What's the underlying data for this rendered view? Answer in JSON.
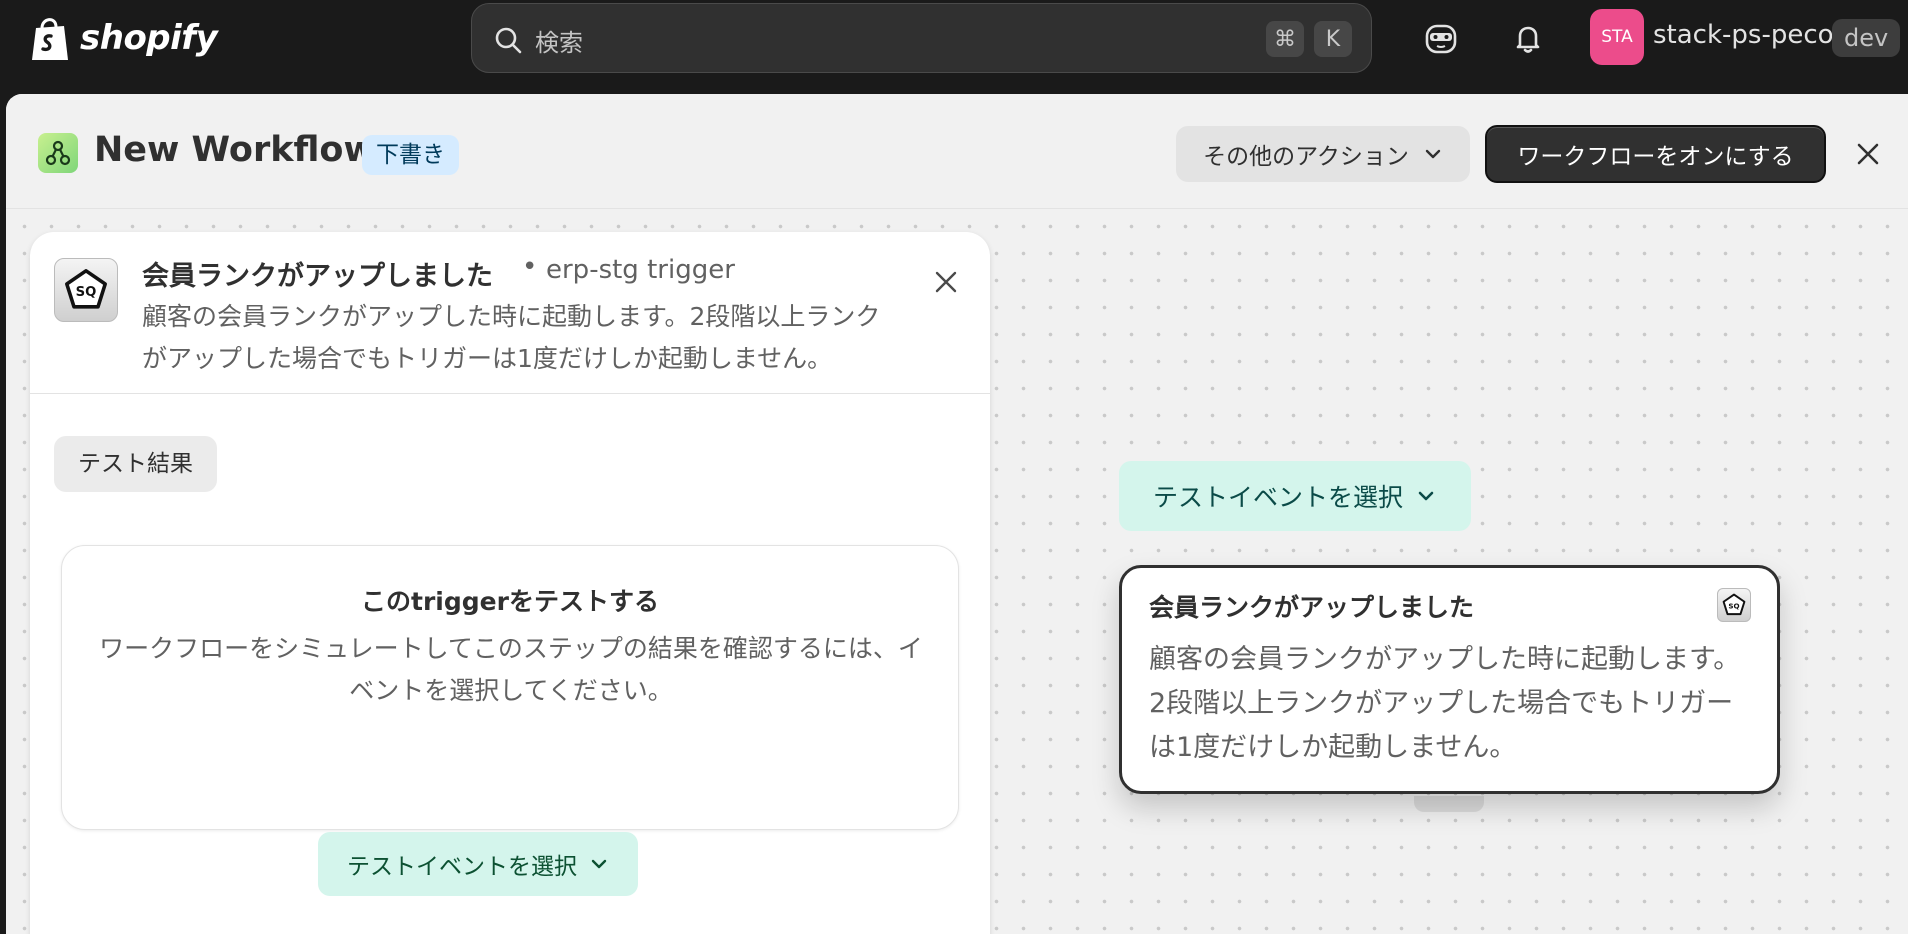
{
  "topbar": {
    "brand": "shopify",
    "search_placeholder": "検索",
    "shortcut_cmd": "⌘",
    "shortcut_key": "K",
    "avatar_initials": "STA",
    "store_name": "stack-ps-peco",
    "store_badge": "dev"
  },
  "header": {
    "title": "New Workflow",
    "status_badge": "下書き",
    "actions_label": "その他のアクション",
    "primary_label": "ワークフローをオンにする"
  },
  "panel": {
    "title": "会員ランクがアップしました",
    "separator": "•",
    "subtitle": "erp-stg trigger",
    "description": "顧客の会員ランクがアップした時に起動します。2段階以上ランクがアップした場合でもトリガーは1度だけしか起動しません。",
    "results_tab": "テスト結果",
    "test_title": "このtriggerをテストする",
    "test_description": "ワークフローをシミュレートしてこのステップの結果を確認するには、イベントを選択してください。",
    "select_event_label": "テストイベントを選択"
  },
  "canvas": {
    "select_event_label": "テストイベントを選択",
    "node_title": "会員ランクがアップしました",
    "node_description": "顧客の会員ランクがアップした時に起動します。2段階以上ランクがアップした場合でもトリガーは1度だけしか起動しません。"
  },
  "colors": {
    "topbar": "#1a1a1a",
    "avatar": "#ec4c8b",
    "draft_badge": "#d5ebff",
    "select_button": "#d4f5ec",
    "primary_button": "#303030"
  }
}
